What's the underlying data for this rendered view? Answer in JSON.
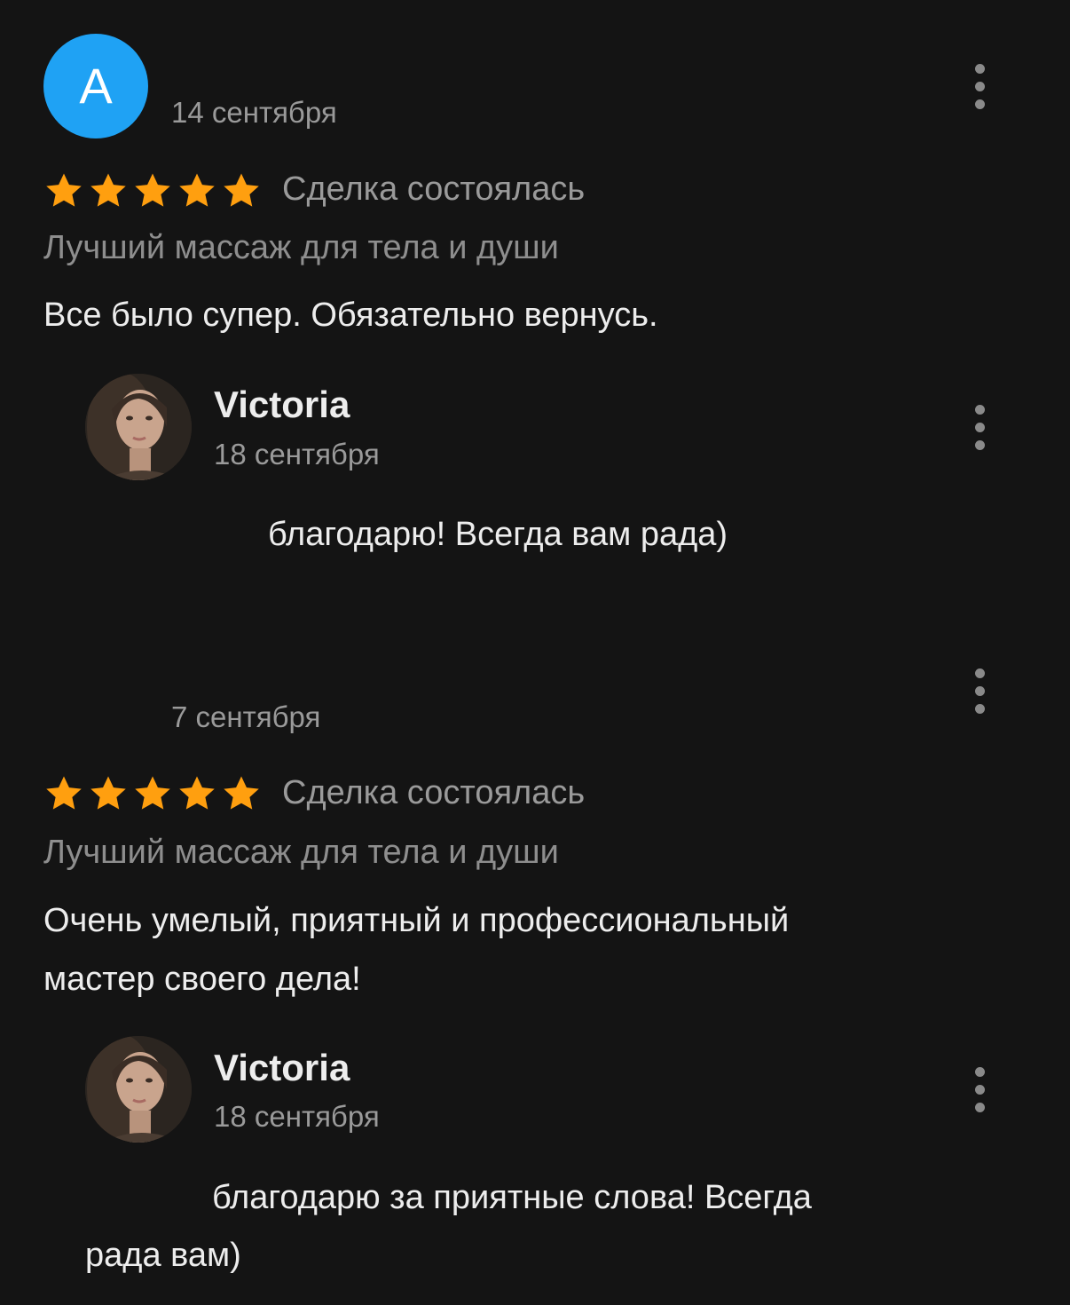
{
  "colors": {
    "background": "#141414",
    "star": "#ff9f0f",
    "avatar_bg": "#1fa2f4",
    "muted_text": "#9a9a9a",
    "primary_text": "#ededed"
  },
  "reviews": [
    {
      "author_initial": "A",
      "date": "14 сентября",
      "rating": 5,
      "status": "Сделка состоялась",
      "service": "Лучший массаж для тела и души",
      "text": "Все было супер. Обязательно вернусь.",
      "reply": {
        "name": "Victoria",
        "date": "18 сентября",
        "text": "благодарю! Всегда вам рада)"
      }
    },
    {
      "date": "7 сентября",
      "rating": 5,
      "status": "Сделка состоялась",
      "service": "Лучший массаж для тела и души",
      "text_line1": "Очень умелый, приятный и профессиональный",
      "text_line2": "мастер своего дела!",
      "reply": {
        "name": "Victoria",
        "date": "18 сентября",
        "text_line1": "благодарю за приятные слова! Всегда",
        "text_line2": "рада вам)"
      }
    }
  ],
  "icons": {
    "star": "star-icon",
    "more": "more-vertical-icon"
  }
}
